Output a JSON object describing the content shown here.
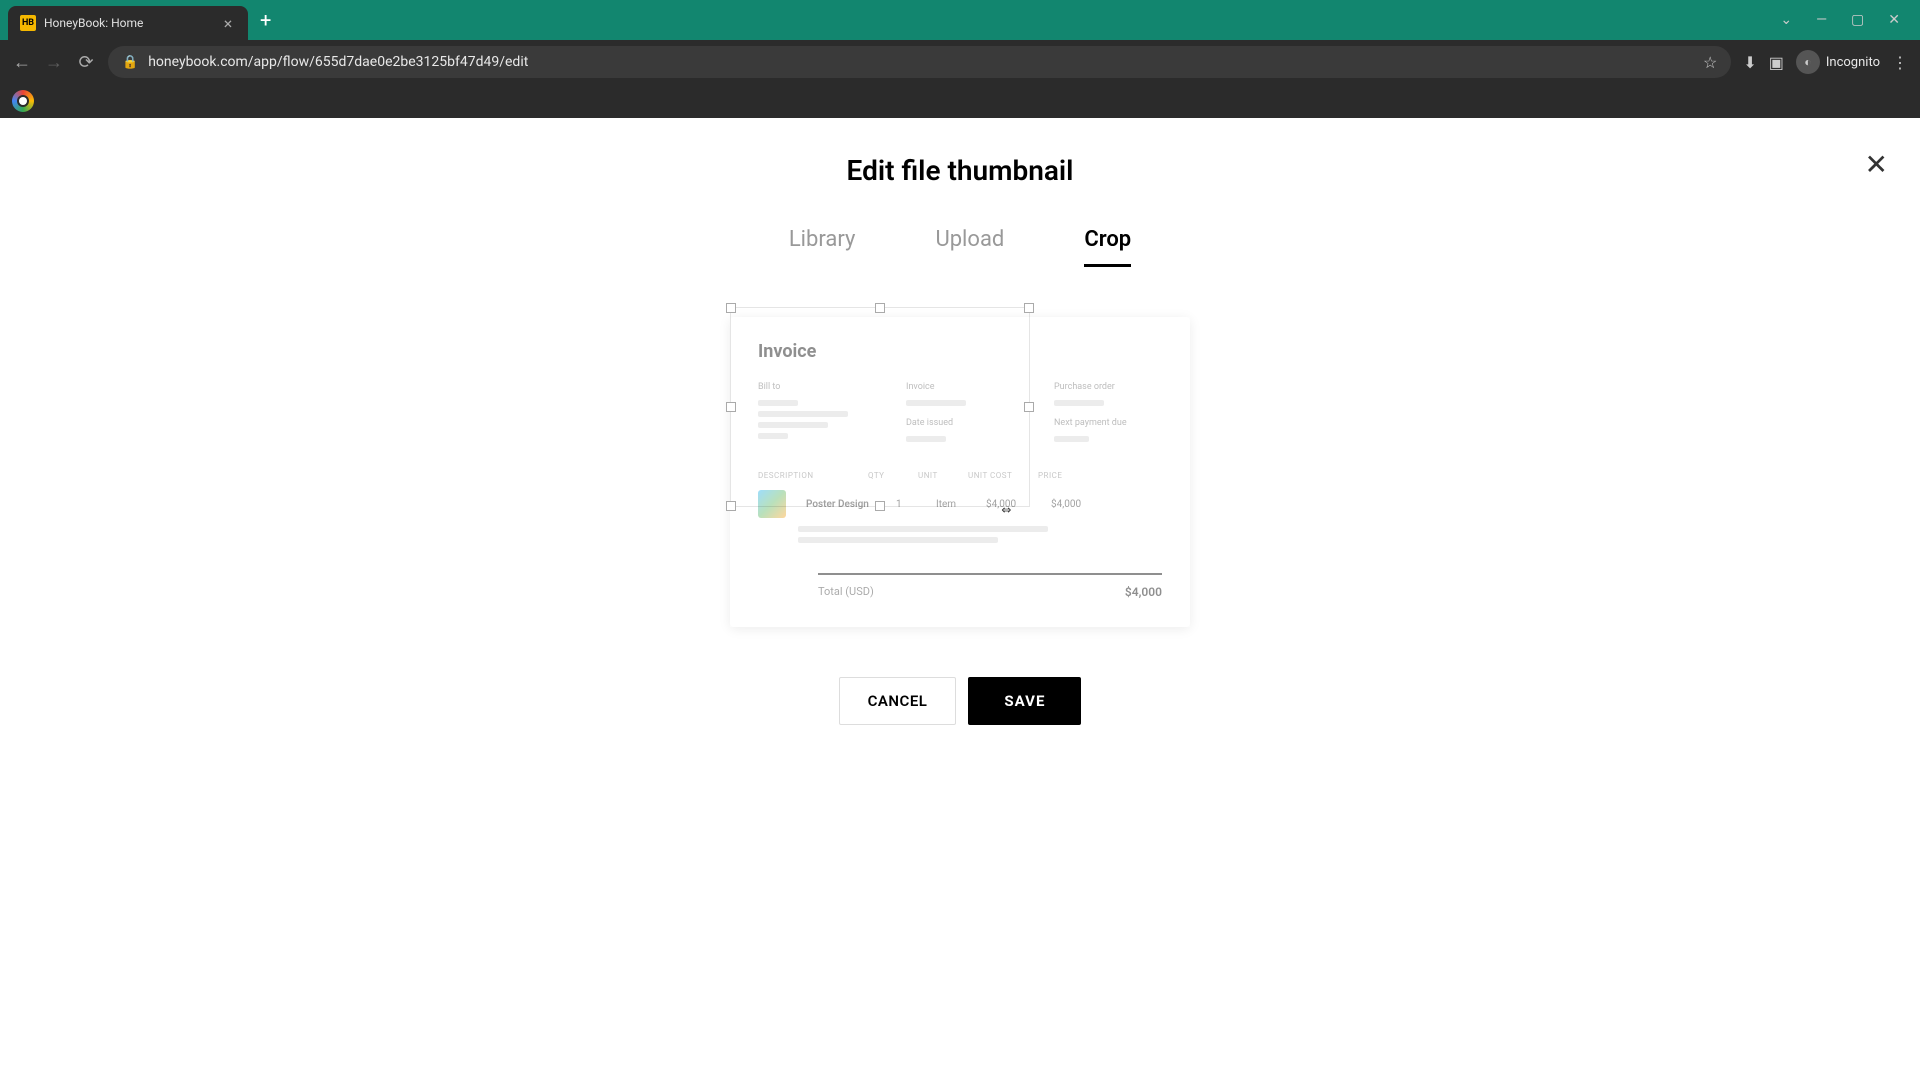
{
  "browser": {
    "tab_title": "HoneyBook: Home",
    "url": "honeybook.com/app/flow/655d7dae0e2be3125bf47d49/edit",
    "incognito_label": "Incognito"
  },
  "modal": {
    "title": "Edit file thumbnail",
    "tabs": {
      "library": "Library",
      "upload": "Upload",
      "crop": "Crop"
    }
  },
  "invoice_preview": {
    "title": "Invoice",
    "labels": {
      "bill_to": "Bill to",
      "invoice": "Invoice",
      "purchase_order": "Purchase order",
      "date_issued": "Date issued",
      "next_payment_due": "Next payment due"
    },
    "headers": {
      "description": "DESCRIPTION",
      "qty": "QTY",
      "unit": "UNIT",
      "unit_cost": "UNIT COST",
      "price": "PRICE"
    },
    "row": {
      "description": "Poster Design",
      "qty": "1",
      "unit": "Item",
      "unit_cost": "$4,000",
      "price": "$4,000"
    },
    "total_label": "Total (USD)",
    "total_value": "$4,000"
  },
  "actions": {
    "cancel": "CANCEL",
    "save": "SAVE"
  }
}
